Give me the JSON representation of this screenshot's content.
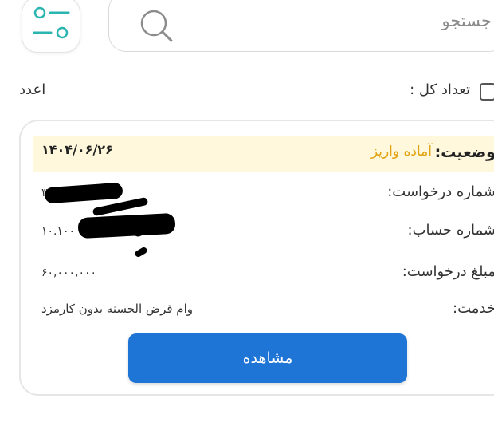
{
  "search": {
    "placeholder": "جستجو"
  },
  "summary": {
    "total_label": "تعداد کل :",
    "total_unit": "اعدد"
  },
  "card": {
    "status_label": "وضعیت:",
    "status_value": "آماده واریز",
    "date": "۱۴۰۴/۰۶/۲۶",
    "request_number_label": "شماره درخواست:",
    "request_number_value": "۳",
    "account_number_label": "شماره حساب:",
    "account_number_value": "۱۰.۱۰۰",
    "amount_label": "مبلغ درخواست:",
    "amount_value": "۶۰,۰۰۰,۰۰۰",
    "service_label": "خدمت:",
    "service_value": "وام قرض الحسنه بدون کارمزد",
    "view_button": "مشاهده"
  },
  "colors": {
    "accent": "#1f75d6",
    "status": "#e2a20f",
    "status_bg": "#fff8dc",
    "filter_icon": "#2bb5b0"
  },
  "icons": {
    "filter": "filter-sliders-icon",
    "search": "search-icon",
    "total": "list-icon"
  }
}
